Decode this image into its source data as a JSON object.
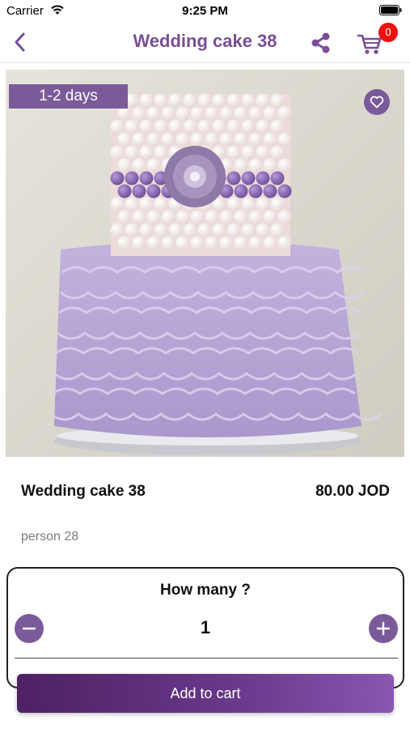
{
  "status_bar": {
    "carrier": "Carrier",
    "time": "9:25 PM"
  },
  "nav": {
    "title": "Wedding cake 38",
    "cart_count": "0",
    "icons": {
      "back": "chevron-left-icon",
      "share": "share-icon",
      "cart": "cart-icon"
    }
  },
  "product": {
    "delivery_badge": "1-2 days",
    "name": "Wedding cake 38",
    "price": "80.00 JOD",
    "description": "person 28",
    "image_subject": "two-tier wedding cake with white pearl top tier, purple pearl band with brooch, lavender ruffled bottom tier"
  },
  "quantity": {
    "title": "How many ?",
    "value": "1"
  },
  "actions": {
    "add_to_cart": "Add to cart"
  },
  "colors": {
    "brand_purple": "#7b5a9a",
    "title_purple": "#7a4f95",
    "badge_red": "#ee1111",
    "button_gradient_start": "#4d2163",
    "button_gradient_end": "#8a56b0"
  }
}
